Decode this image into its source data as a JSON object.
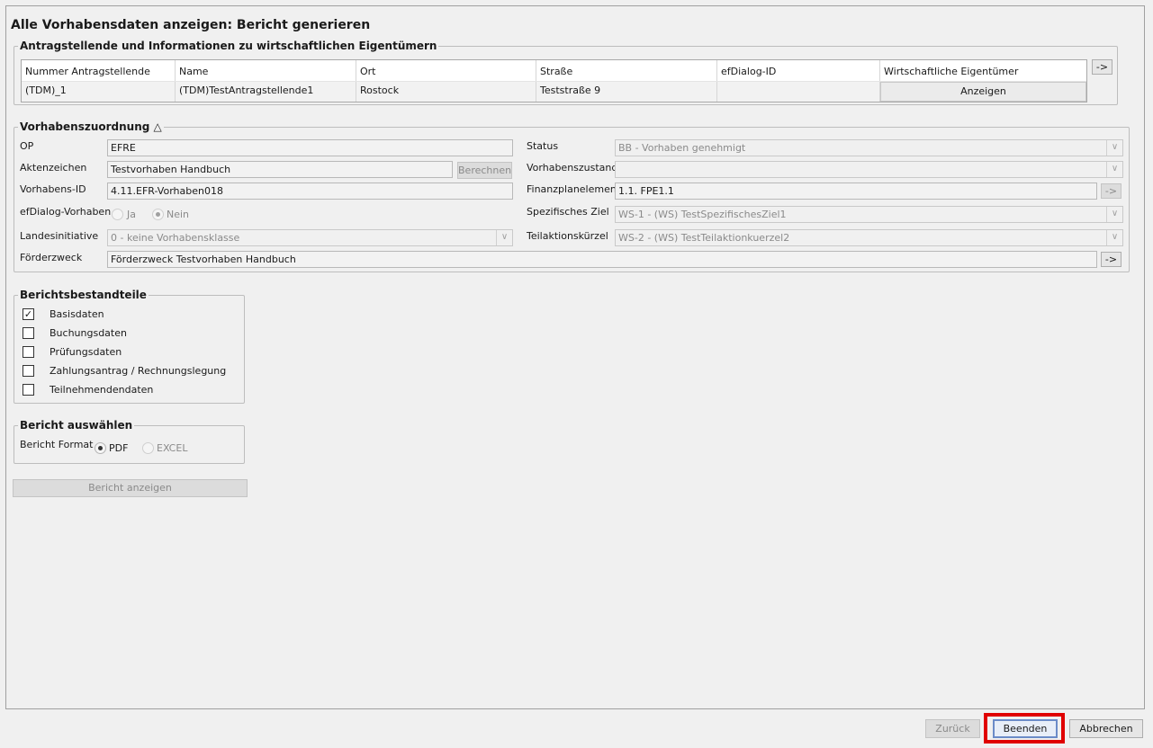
{
  "page_title": "Alle Vorhabensdaten anzeigen: Bericht generieren",
  "applicants": {
    "title": "Antragstellende und Informationen zu wirtschaftlichen Eigentümern",
    "columns": [
      "Nummer Antragstellende",
      "Name",
      "Ort",
      "Straße",
      "efDialog-ID",
      "Wirtschaftliche Eigentümer"
    ],
    "row": {
      "nummer": "(TDM)_1",
      "name": "(TDM)TestAntragstellende1",
      "ort": "Rostock",
      "strasse": "Teststraße 9",
      "efdialog_id": "",
      "anzeigen_button": "Anzeigen"
    },
    "arrow_button": "->"
  },
  "assignment": {
    "title": "Vorhabenszuordnung",
    "collapse_icon": "triangle-up-icon",
    "op_label": "OP",
    "op_value": "EFRE",
    "aktenzeichen_label": "Aktenzeichen",
    "aktenzeichen_value": "Testvorhaben Handbuch",
    "berechnen_button": "Berechnen",
    "vorhabens_id_label": "Vorhabens-ID",
    "vorhabens_id_value": "4.11.EFR-Vorhaben018",
    "efdialog_label": "efDialog-Vorhaben",
    "efdialog_ja": "Ja",
    "efdialog_nein": "Nein",
    "efdialog_selected": "Nein",
    "landesinitiative_label": "Landesinitiative",
    "landesinitiative_value": "0 - keine Vorhabensklasse",
    "foerderzweck_label": "Förderzweck",
    "foerderzweck_value": "Förderzweck Testvorhaben Handbuch",
    "status_label": "Status",
    "status_value": "BB - Vorhaben genehmigt",
    "zustand_label": "Vorhabenszustand",
    "zustand_value": "",
    "finanzplan_label": "Finanzplanelement",
    "finanzplan_value": "1.1. FPE1.1",
    "ziel_label": "Spezifisches Ziel",
    "ziel_value": "WS-1 - (WS) TestSpezifischesZiel1",
    "teilaktion_label": "Teilaktionskürzel",
    "teilaktion_value": "WS-2 - (WS) TestTeilaktionkuerzel2",
    "arrow_button": "->"
  },
  "report_parts": {
    "title": "Berichtsbestandteile",
    "items": [
      {
        "label": "Basisdaten",
        "checked": true
      },
      {
        "label": "Buchungsdaten",
        "checked": false
      },
      {
        "label": "Prüfungsdaten",
        "checked": false
      },
      {
        "label": "Zahlungsantrag / Rechnungslegung",
        "checked": false
      },
      {
        "label": "Teilnehmendendaten",
        "checked": false
      }
    ]
  },
  "report_select": {
    "title": "Bericht auswählen",
    "format_label": "Bericht Format",
    "pdf": "PDF",
    "excel": "EXCEL",
    "selected": "PDF"
  },
  "show_report_button": "Bericht anzeigen",
  "footer": {
    "back": "Zurück",
    "finish": "Beenden",
    "cancel": "Abbrechen"
  },
  "colors": {
    "highlight": "#e00000",
    "background": "#f0f0f0"
  }
}
